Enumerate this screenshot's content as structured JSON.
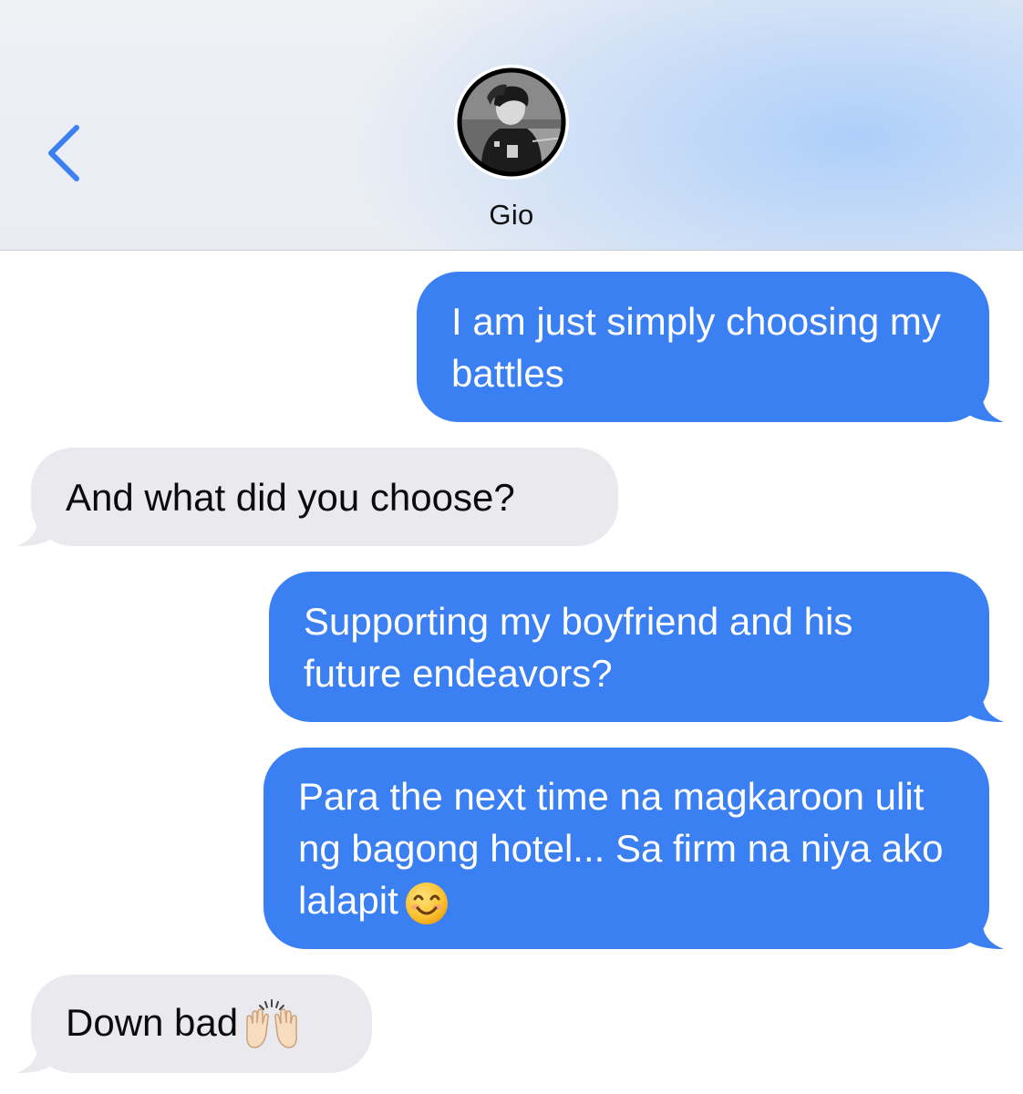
{
  "header": {
    "contact_name": "Gio",
    "back_icon": "chevron-left-icon",
    "accent_color": "#3b80f3"
  },
  "messages": [
    {
      "direction": "sent",
      "text": "I am just simply choosing my battles",
      "emoji": ""
    },
    {
      "direction": "received",
      "text": "And what did you choose?",
      "emoji": ""
    },
    {
      "direction": "sent",
      "text": "Supporting my boyfriend and his future endeavors?",
      "emoji": ""
    },
    {
      "direction": "sent",
      "text": "Para the next time na magkaroon ulit ng bagong hotel... Sa firm na niya ako lalapit",
      "emoji": "smiling-face-icon"
    },
    {
      "direction": "received",
      "text": "Down bad",
      "emoji": "raising-hands-icon"
    }
  ],
  "colors": {
    "sent_bubble": "#3b80f3",
    "received_bubble": "#e9e9ee"
  }
}
